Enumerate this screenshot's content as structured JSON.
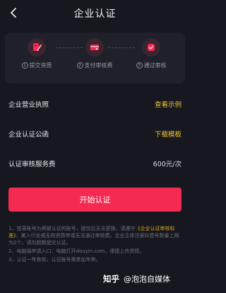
{
  "nav": {
    "title": "企业认证"
  },
  "steps": [
    {
      "num": "1",
      "label": "提交资质",
      "icon": "document-pen-icon"
    },
    {
      "num": "2",
      "label": "支付审核费",
      "icon": "card-payment-icon"
    },
    {
      "num": "3",
      "label": "通过审核",
      "icon": "badge-check-icon"
    }
  ],
  "rows": {
    "license": {
      "label": "企业营业执照",
      "action": "查看示例"
    },
    "letter": {
      "label": "企业认证公函",
      "action": "下载模板"
    },
    "fee": {
      "label": "认证审核服务费",
      "value": "600元/次"
    }
  },
  "button": {
    "label": "开始认证"
  },
  "notes": {
    "n1_a": "1、登录账号为将被认证的账号，提交后无法更换，请遵守",
    "n1_link": "《企业认证审核标准》",
    "n1_b": "，某入行业或无效资质申请无法通过审核费。企业主体注册抖音号数量上限为2个，请勿超额提交认证。",
    "n2": "2、电脑端申请入口：电脑打开douyin.com，便捷上传资质。",
    "n3": "3、认证一年有效，认证账号需参加年审。"
  },
  "watermark": {
    "logo": "知乎",
    "handle": "@泡泡自媒体"
  },
  "colors": {
    "accent": "#f42a52",
    "link": "#f4c433",
    "background": "#16171f"
  }
}
